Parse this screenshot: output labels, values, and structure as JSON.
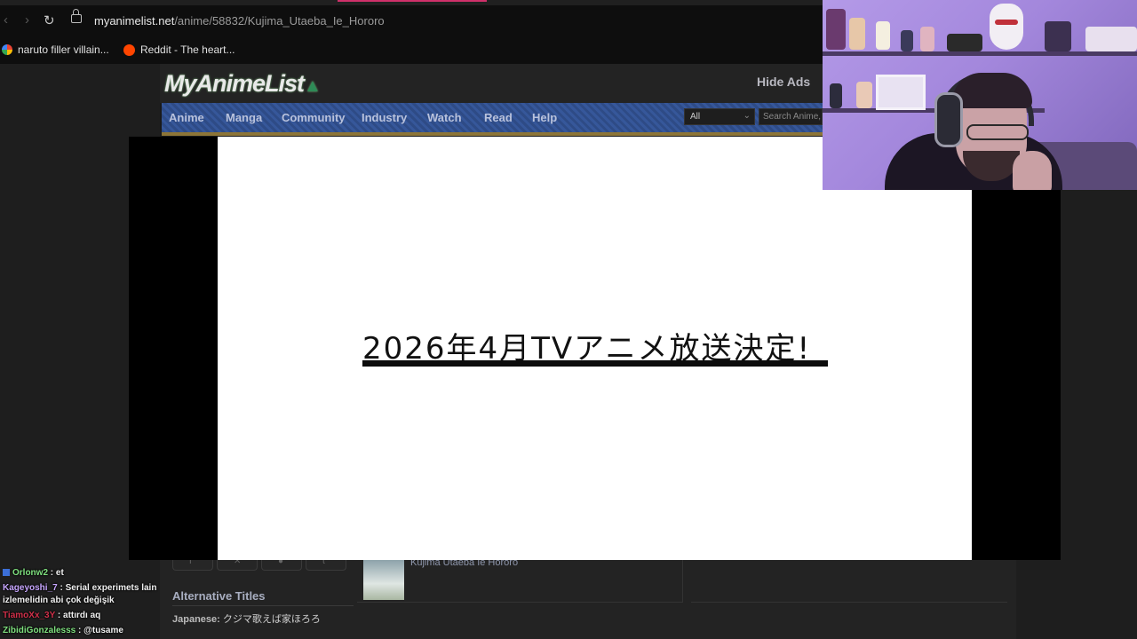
{
  "browser": {
    "url_domain": "myanimelist.net",
    "url_path": "/anime/58832/Kujima_Utaeba_Ie_Hororo",
    "bookmarks": [
      {
        "label": "naruto filler villain...",
        "icon": "google-icon"
      },
      {
        "label": "Reddit - The heart...",
        "icon": "reddit-icon"
      }
    ]
  },
  "mal": {
    "logo": "MyAnimeList",
    "hide_ads": "Hide Ads",
    "nav": [
      "Anime",
      "Manga",
      "Community",
      "Industry",
      "Watch",
      "Read",
      "Help"
    ],
    "search_category": "All",
    "search_placeholder": "Search Anime,",
    "alt_titles_heading": "Alternative Titles",
    "japanese_label": "Japanese:",
    "japanese_value": "クジマ歌えば家ほろろ",
    "related_title": "Kujima Utaeba Ie Hororo"
  },
  "video": {
    "caption": "2026年4月TVアニメ放送決定!"
  },
  "chat": [
    {
      "user": "Orlonw2",
      "user_color": "#7fe07f",
      "message": "et",
      "badge": true
    },
    {
      "user": "Kageyoshi_7",
      "user_color": "#c7a6ff",
      "message": "Serial experimets lain",
      "continuation": "izlemelidin abi çok değişik"
    },
    {
      "user": "TiamoXx_3Y",
      "user_color": "#d0304a",
      "message": "attırdı aq"
    },
    {
      "user": "ZibidiGonzalesss",
      "user_color": "#7fe07f",
      "message": "@tusame"
    }
  ],
  "colors": {
    "mal_nav": "#2e4b86",
    "mal_bg": "#232323",
    "webcam_tint": "#a387dc"
  }
}
